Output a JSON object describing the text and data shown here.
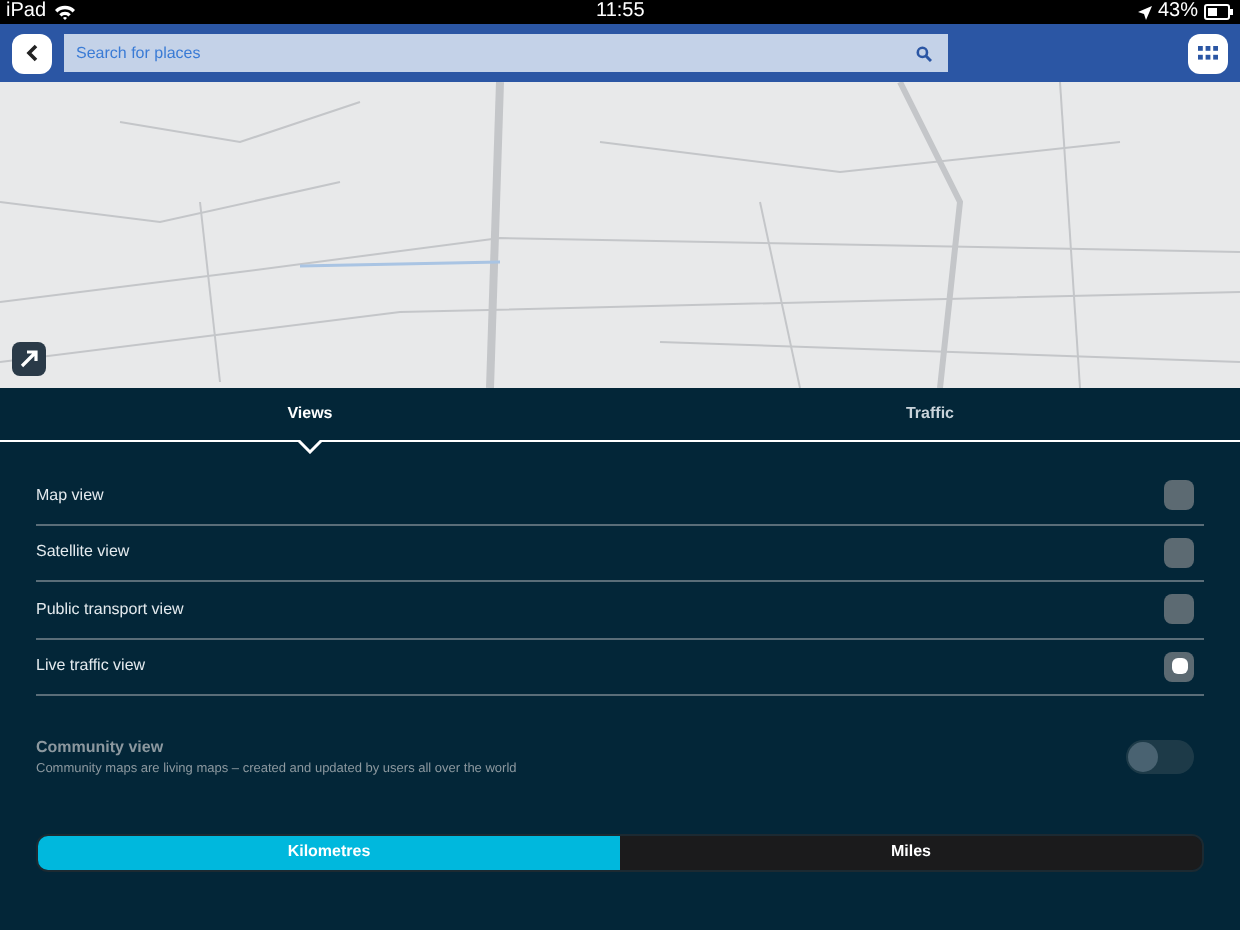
{
  "status_bar": {
    "device": "iPad",
    "time": "11:55",
    "battery": "43%"
  },
  "search": {
    "placeholder": "Search for places"
  },
  "tabs": [
    {
      "label": "Views",
      "selected": true
    },
    {
      "label": "Traffic",
      "selected": false
    }
  ],
  "views": [
    {
      "label": "Map view",
      "checked": false
    },
    {
      "label": "Satellite view",
      "checked": false
    },
    {
      "label": "Public transport view",
      "checked": false
    },
    {
      "label": "Live traffic view",
      "checked": true
    }
  ],
  "community": {
    "title": "Community view",
    "description": "Community maps are living maps – created and updated by users all over the world",
    "on": false,
    "disabled": true
  },
  "units": [
    {
      "label": "Kilometres",
      "selected": true
    },
    {
      "label": "Miles",
      "selected": false
    }
  ]
}
